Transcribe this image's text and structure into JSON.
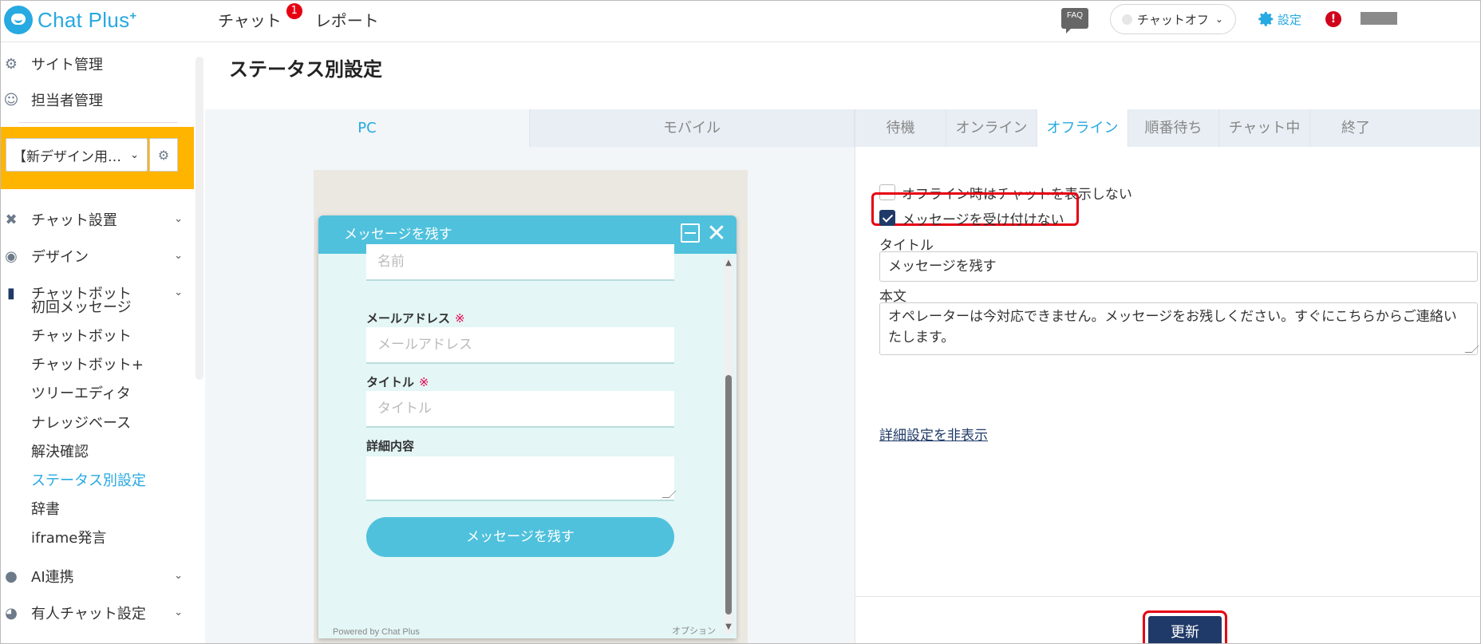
{
  "brand": {
    "name": "Chat Plus",
    "plus": "+"
  },
  "topnav": {
    "chat": "チャット",
    "chat_badge": "1",
    "report": "レポート"
  },
  "header": {
    "faq": "FAQ",
    "status": "チャットオフ",
    "settings": "設定",
    "alert": "!"
  },
  "sidebar": {
    "site_mgmt": "サイト管理",
    "staff_mgmt": "担当者管理",
    "site_select": "【新デザイン用…",
    "chat_setup": "チャット設置",
    "design": "デザイン",
    "chatbot": "チャットボット",
    "chatbot_items": [
      "初回メッセージ",
      "チャットボット",
      "チャットボット+",
      "ツリーエディタ",
      "ナレッジベース",
      "解決確認",
      "ステータス別設定",
      "辞書",
      "iframe発言"
    ],
    "ai": "AI連携",
    "manned": "有人チャット設定"
  },
  "page": {
    "title": "ステータス別設定"
  },
  "device_tabs": [
    "PC",
    "モバイル"
  ],
  "status_tabs": [
    "待機",
    "オンライン",
    "オフライン",
    "順番待ち",
    "チャット中",
    "終了"
  ],
  "widget": {
    "title": "メッセージを残す",
    "name_placeholder": "名前",
    "email_label": "メールアドレス",
    "email_placeholder": "メールアドレス",
    "title_label": "タイトル",
    "title_placeholder": "タイトル",
    "detail_label": "詳細内容",
    "required_mark": "※",
    "submit": "メッセージを残す",
    "powered": "Powered by Chat Plus",
    "option": "オプション"
  },
  "form": {
    "hide_chat_offline": "オフライン時はチャットを表示しない",
    "no_accept_message": "メッセージを受け付けない",
    "title_label": "タイトル",
    "title_value": "メッセージを残す",
    "body_label": "本文",
    "body_value": "オペレーターは今対応できません。メッセージをお残しください。すぐにこちらからご連絡いたします。",
    "detail_toggle": "詳細設定を非表示",
    "update": "更新"
  }
}
